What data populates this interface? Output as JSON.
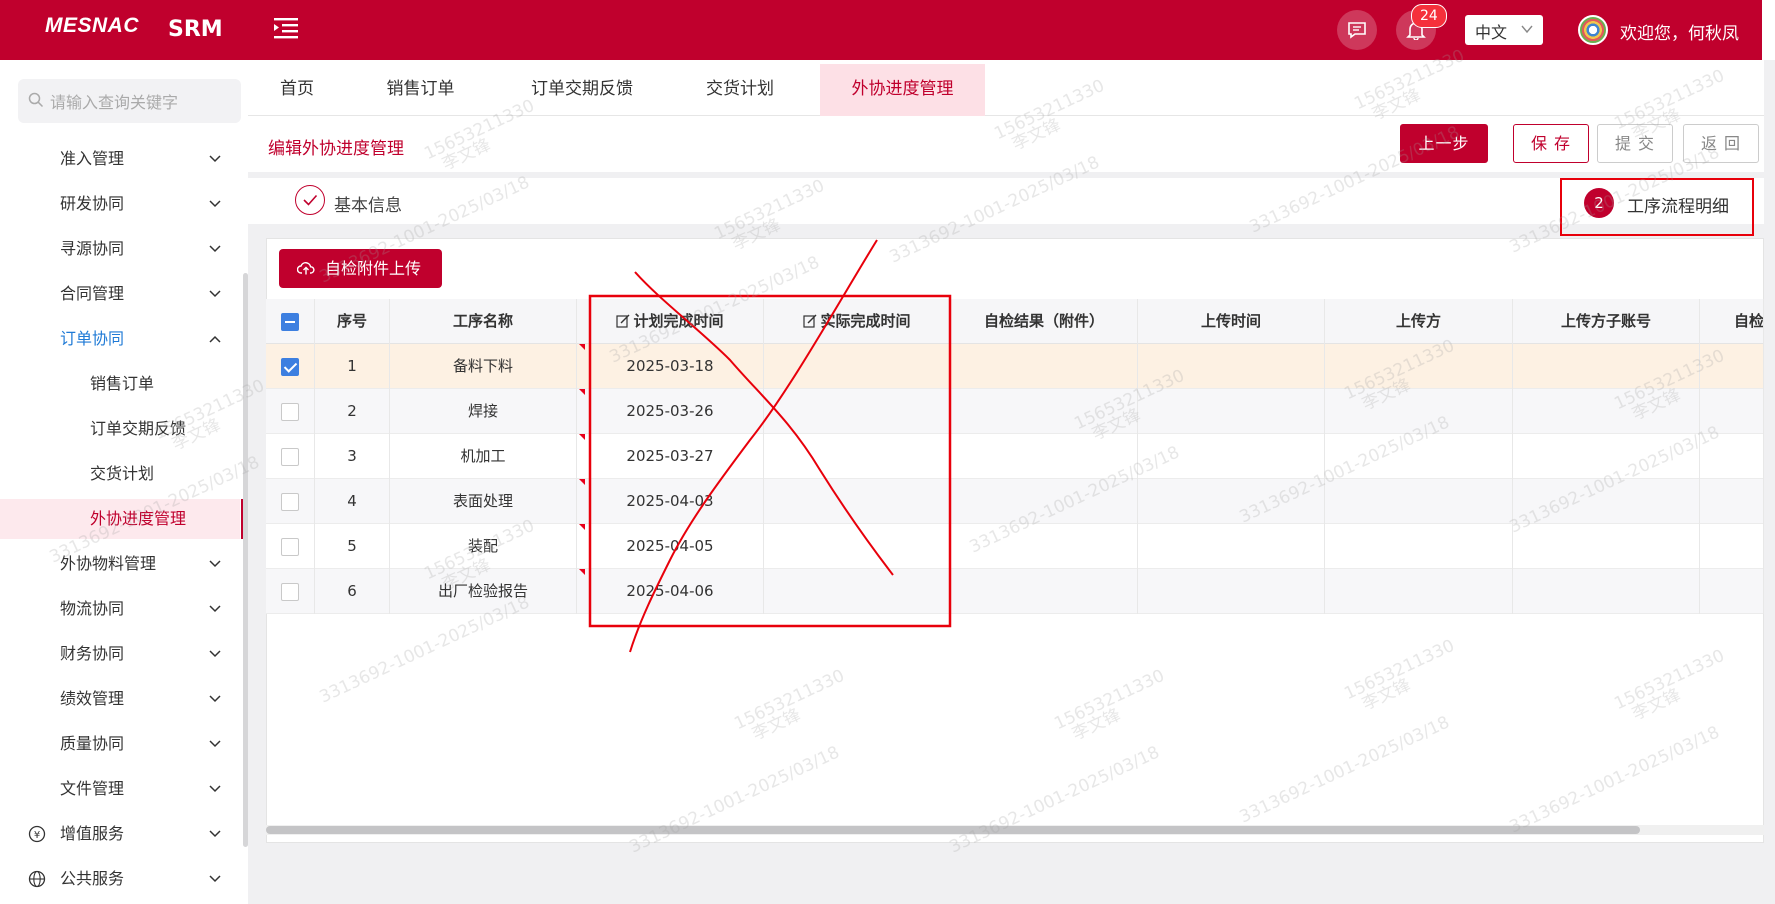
{
  "header": {
    "logo": "MESNAC",
    "app_name": "SRM",
    "notification_count": "24",
    "language": "中文",
    "welcome": "欢迎您，何秋凤",
    "icons": [
      "menu-fold-icon",
      "message-icon",
      "bell-icon",
      "chevron-down-icon"
    ]
  },
  "sidebar": {
    "search_placeholder": "请输入查询关键字",
    "items": [
      {
        "label": "准入管理",
        "icon": "chevron-down-icon"
      },
      {
        "label": "研发协同",
        "icon": "chevron-down-icon"
      },
      {
        "label": "寻源协同",
        "icon": "chevron-down-icon"
      },
      {
        "label": "合同管理",
        "icon": "chevron-down-icon"
      },
      {
        "label": "订单协同",
        "icon": "chevron-up-icon",
        "state": "expanded"
      },
      {
        "label": "销售订单"
      },
      {
        "label": "订单交期反馈"
      },
      {
        "label": "交货计划"
      },
      {
        "label": "外协进度管理",
        "state": "active"
      },
      {
        "label": "外协物料管理",
        "icon": "chevron-down-icon"
      },
      {
        "label": "物流协同",
        "icon": "chevron-down-icon"
      },
      {
        "label": "财务协同",
        "icon": "chevron-down-icon"
      },
      {
        "label": "绩效管理",
        "icon": "chevron-down-icon"
      },
      {
        "label": "质量协同",
        "icon": "chevron-down-icon"
      },
      {
        "label": "文件管理",
        "icon": "chevron-down-icon"
      },
      {
        "label": "增值服务",
        "icon": "yen-icon"
      },
      {
        "label": "公共服务",
        "icon": "globe-icon"
      }
    ]
  },
  "tabs": [
    {
      "label": "首页"
    },
    {
      "label": "销售订单"
    },
    {
      "label": "订单交期反馈"
    },
    {
      "label": "交货计划"
    },
    {
      "label": "外协进度管理",
      "active": true
    }
  ],
  "page": {
    "title": "编辑外协进度管理",
    "buttons": {
      "prev": "上一步",
      "save": "保 存",
      "submit": "提 交",
      "back": "返 回"
    },
    "steps": [
      {
        "label": "基本信息",
        "state": "done"
      },
      {
        "number": "2",
        "label": "工序流程明细",
        "state": "current"
      }
    ],
    "upload_label": "自检附件上传"
  },
  "table": {
    "columns": [
      "序号",
      "工序名称",
      "计划完成时间",
      "实际完成时间",
      "自检结果（附件）",
      "上传时间",
      "上传方",
      "上传方子账号",
      "自检"
    ],
    "rows": [
      {
        "no": "1",
        "name": "备料下料",
        "planned": "2025-03-18",
        "actual": "",
        "checked": true
      },
      {
        "no": "2",
        "name": "焊接",
        "planned": "2025-03-26",
        "actual": "",
        "checked": false
      },
      {
        "no": "3",
        "name": "机加工",
        "planned": "2025-03-27",
        "actual": "",
        "checked": false
      },
      {
        "no": "4",
        "name": "表面处理",
        "planned": "2025-04-03",
        "actual": "",
        "checked": false
      },
      {
        "no": "5",
        "name": "装配",
        "planned": "2025-04-05",
        "actual": "",
        "checked": false
      },
      {
        "no": "6",
        "name": "出厂检验报告",
        "planned": "2025-04-06",
        "actual": "",
        "checked": false
      }
    ]
  },
  "watermark": {
    "id_line": "3313692-1001-2025/03/18",
    "phone": "15653211330",
    "name": "李文锋"
  },
  "colors": {
    "brand": "#c0002d",
    "annotation": "#e8000b",
    "checkbox": "#3d7fe0"
  }
}
